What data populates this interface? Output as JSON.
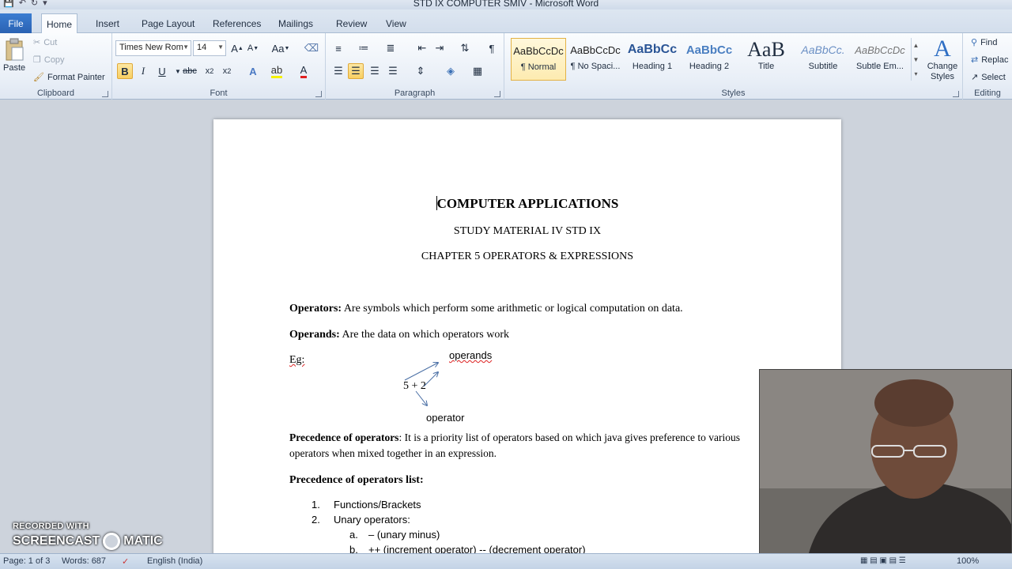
{
  "window": {
    "title": "STD IX COMPUTER SMIV  -  Microsoft Word"
  },
  "tabs": [
    "File",
    "Home",
    "Insert",
    "Page Layout",
    "References",
    "Mailings",
    "Review",
    "View"
  ],
  "clipboard": {
    "paste": "Paste",
    "cut": "Cut",
    "copy": "Copy",
    "format_painter": "Format Painter",
    "label": "Clipboard"
  },
  "font": {
    "name": "Times New Rom",
    "size": "14",
    "label": "Font"
  },
  "paragraph": {
    "label": "Paragraph"
  },
  "styles": {
    "label": "Styles",
    "items": [
      {
        "sample": "AaBbCcDc",
        "name": "¶ Normal"
      },
      {
        "sample": "AaBbCcDc",
        "name": "¶ No Spaci..."
      },
      {
        "sample": "AaBbCc",
        "name": "Heading 1"
      },
      {
        "sample": "AaBbCc",
        "name": "Heading 2"
      },
      {
        "sample": "AaB",
        "name": "Title"
      },
      {
        "sample": "AaBbCc.",
        "name": "Subtitle"
      },
      {
        "sample": "AaBbCcDc",
        "name": "Subtle Em..."
      }
    ],
    "change_styles": "Change Styles"
  },
  "editing": {
    "label": "Editing",
    "find": "Find",
    "replace": "Replac",
    "select": "Select"
  },
  "document": {
    "title": "COMPUTER APPLICATIONS",
    "subtitle": "STUDY MATERIAL IV STD IX",
    "chapter": "CHAPTER 5 OPERATORS & EXPRESSIONS",
    "operators_term": "Operators:",
    "operators_def": " Are symbols which perform some arithmetic or logical computation on data.",
    "operands_term": "Operands:",
    "operands_def": " Are the data on which operators work",
    "eg": "Eg:",
    "diagram_top": "operands",
    "diagram_expr": "5 + 2",
    "diagram_bottom": "operator",
    "precedence_term": "Precedence of operators",
    "precedence_def": ": It is a priority list of operators based on which java gives preference to various operators when mixed together in an expression.",
    "list_heading": "Precedence of operators list:",
    "list": [
      {
        "num": "1.",
        "text": "Functions/Brackets"
      },
      {
        "num": "2.",
        "text": "Unary operators:"
      }
    ],
    "sublist": [
      {
        "num": "a.",
        "text": "– (unary minus)"
      },
      {
        "num": "b.",
        "text": "++ (increment operator) -- (decrement operator)"
      }
    ]
  },
  "watermark": {
    "line1": "RECORDED WITH",
    "line2a": "SCREENCAST",
    "line2b": "MATIC"
  },
  "status": {
    "page": "Page: 1 of 3",
    "words": "Words: 687",
    "language": "English (India)",
    "zoom": "100%"
  }
}
